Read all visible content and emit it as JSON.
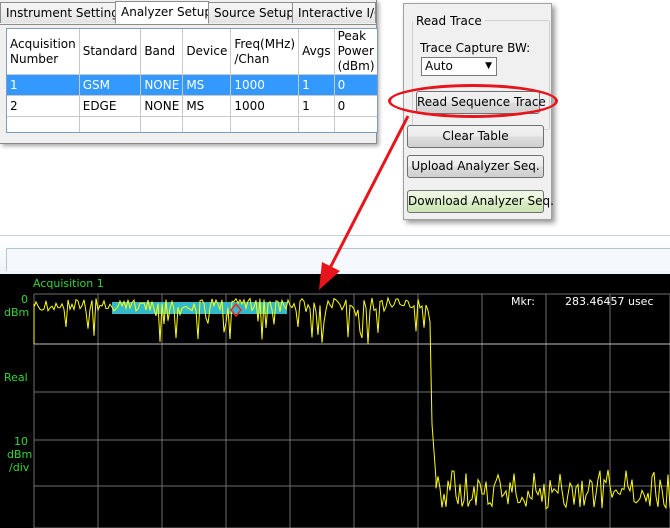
{
  "tabs": [
    {
      "label": "Instrument Settings"
    },
    {
      "label": "Analyzer Setup"
    },
    {
      "label": "Source Setup"
    },
    {
      "label": "Interactive I/O"
    }
  ],
  "table": {
    "headers": [
      "Acquisition Number",
      "Standard",
      "Band",
      "Device",
      "Freq(MHz) /Chan",
      "Avgs",
      "Peak Power (dBm)"
    ],
    "rows": [
      [
        "1",
        "GSM",
        "NONE",
        "MS",
        "1000",
        "1",
        "0"
      ],
      [
        "2",
        "EDGE",
        "NONE",
        "MS",
        "1000",
        "1",
        "0"
      ]
    ]
  },
  "read_trace": {
    "title": "Read Trace",
    "bw_label": "Trace Capture BW:",
    "bw_value": "Auto"
  },
  "buttons": {
    "read_sequence": "Read Sequence Trace",
    "clear_table": "Clear Table",
    "upload": "Upload Analyzer Seq.",
    "download": "Download Analyzer Seq."
  },
  "plot": {
    "title": "Acquisition 1",
    "ref_value": "0",
    "ref_unit": "dBm",
    "format": "Real",
    "scale_value": "10",
    "scale_unit": "dBm",
    "scale_div": "/div",
    "marker_label": "Mkr:",
    "marker_value": "283.46457 usec"
  },
  "colors": {
    "trace": "#ffff00",
    "label_green": "#33d633",
    "grid": "#8a8a8a",
    "selection_bar": "#31b9cc",
    "marker": "#ff2020",
    "annotation": "#e8141b",
    "row_select": "#3399ff"
  }
}
